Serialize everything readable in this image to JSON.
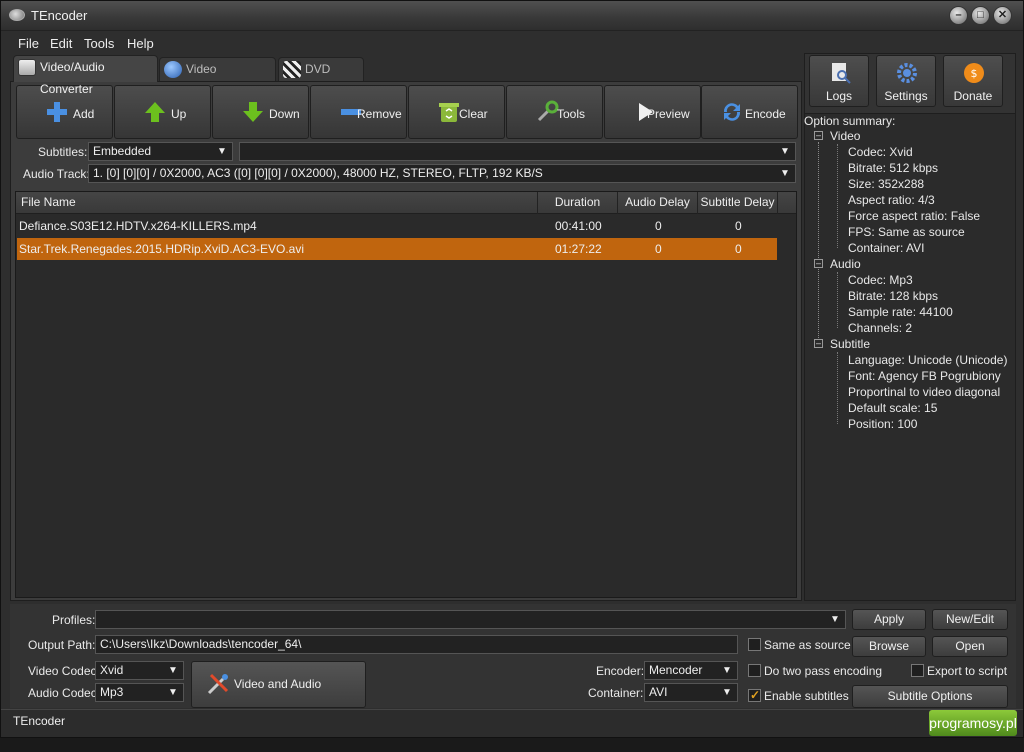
{
  "window": {
    "title": "TEncoder"
  },
  "menu": [
    "File",
    "Edit",
    "Tools",
    "Help"
  ],
  "tabs": [
    "Video/Audio Converter",
    "Video Downloader",
    "DVD Ripper"
  ],
  "toolbar": [
    "Add",
    "Up",
    "Down",
    "Remove",
    "Clear",
    "Tools",
    "Preview",
    "Encode"
  ],
  "right_buttons": [
    "Logs",
    "Settings",
    "Donate"
  ],
  "subtitles": {
    "label": "Subtitles:",
    "value": "Embedded",
    "second_value": ""
  },
  "audio_track": {
    "label": "Audio Track:",
    "value": "1. [0] [0][0] / 0X2000, AC3 ([0] [0][0] / 0X2000), 48000 HZ, STEREO, FLTP, 192 KB/S"
  },
  "table": {
    "columns": [
      "File Name",
      "Duration",
      "Audio Delay",
      "Subtitle Delay"
    ],
    "rows": [
      {
        "name": "Defiance.S03E12.HDTV.x264-KILLERS.mp4",
        "duration": "00:41:00",
        "audio_delay": "0",
        "subtitle_delay": "0"
      },
      {
        "name": "Star.Trek.Renegades.2015.HDRip.XviD.AC3-EVO.avi",
        "duration": "01:27:22",
        "audio_delay": "0",
        "subtitle_delay": "0"
      }
    ]
  },
  "summary": {
    "label": "Option summary:",
    "video": {
      "title": "Video",
      "items": [
        "Codec: Xvid",
        "Bitrate: 512 kbps",
        "Size: 352x288",
        "Aspect ratio: 4/3",
        "Force aspect ratio: False",
        "FPS: Same as source",
        "Container: AVI"
      ]
    },
    "audio": {
      "title": "Audio",
      "items": [
        "Codec: Mp3",
        "Bitrate: 128 kbps",
        "Sample rate: 44100",
        "Channels: 2"
      ]
    },
    "subtitle": {
      "title": "Subtitle",
      "items": [
        "Language: Unicode (Unicode)",
        "Font: Agency FB Pogrubiony",
        "Proportinal to video diagonal",
        "Default scale: 15",
        "Position: 100"
      ]
    }
  },
  "bottom": {
    "profiles_label": "Profiles:",
    "profiles_value": "",
    "apply": "Apply",
    "new_edit": "New/Edit",
    "output_label": "Output Path:",
    "output_value": "C:\\Users\\Ikz\\Downloads\\tencoder_64\\",
    "same_as_source": "Same as source",
    "browse": "Browse",
    "open": "Open",
    "video_codec_label": "Video Codec:",
    "video_codec": "Xvid",
    "audio_codec_label": "Audio Codec:",
    "audio_codec": "Mp3",
    "va_options": "Video and Audio Options",
    "encoder_label": "Encoder:",
    "encoder": "Mencoder",
    "container_label": "Container:",
    "container": "AVI",
    "two_pass": "Do two pass encoding",
    "export_script": "Export to script",
    "enable_subtitles": "Enable subtitles",
    "subtitle_options": "Subtitle Options"
  },
  "status": {
    "text": "TEncoder",
    "watermark": "programosy.pl"
  }
}
